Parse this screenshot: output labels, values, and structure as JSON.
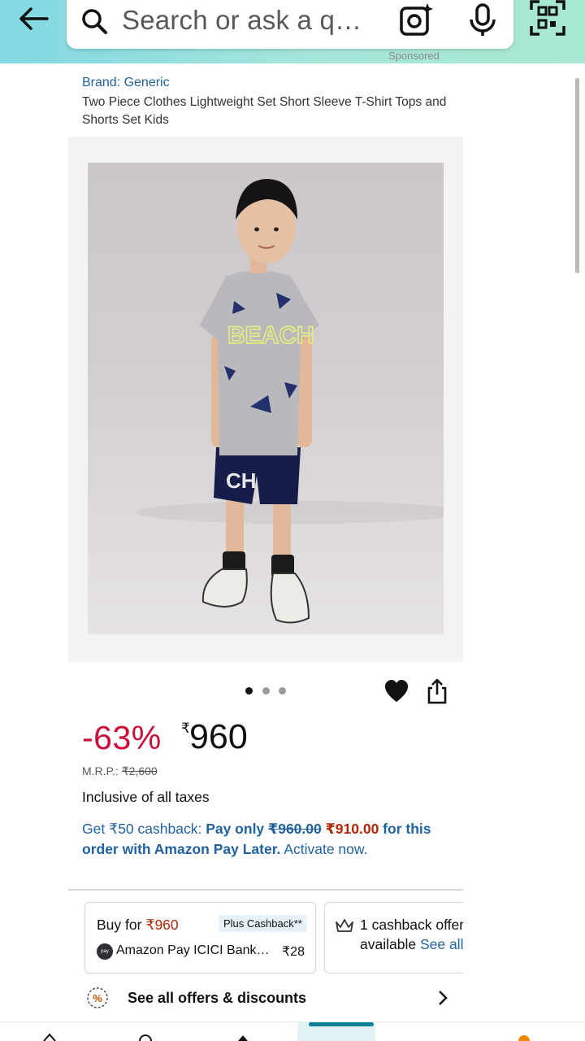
{
  "header": {
    "search_placeholder": "Search or ask a q…",
    "back_icon": "arrow-left-icon",
    "search_icon": "magnifier-icon",
    "lens_icon": "camera-lens-icon",
    "mic_icon": "microphone-icon",
    "qr_icon": "qr-scan-icon",
    "colors": {
      "gradient_start": "#82d8e3",
      "gradient_end": "#a9e8d1"
    }
  },
  "product": {
    "sponsored_label": "Sponsored",
    "brand": "Brand: Generic",
    "title": "Two Piece Clothes Lightweight Set Short Sleeve T-Shirt Tops and Shorts Set Kids",
    "image_count": 3,
    "active_image_index": 0,
    "tshirt_print": "BEACH",
    "discount": "-63%",
    "currency_symbol": "₹",
    "price": "960",
    "mrp_label": "M.R.P.:",
    "mrp_value": "₹2,600",
    "tax_note": "Inclusive of all taxes"
  },
  "cashback": {
    "part1": "Get ₹50 cashback: ",
    "part2": "Pay only ",
    "old_price": "₹960.00",
    "space": " ",
    "new_price": "₹910.00",
    "part3": " for this order with Amazon Pay Later.",
    "activate": " Activate now."
  },
  "offers": {
    "card1": {
      "buy_for": "Buy for ",
      "buy_price": "₹960",
      "tag": "Plus Cashback**",
      "bank_icon_text": "pay",
      "bank": "Amazon Pay ICICI Bank…",
      "amount": "₹28"
    },
    "card2": {
      "line1": "1 cashback offer",
      "line2": "available ",
      "link": "See all"
    },
    "see_all": "See all offers & discounts"
  },
  "colors": {
    "discount_red": "#cc0c39",
    "price_red": "#b12704",
    "link_blue": "#2162a1",
    "nav_accent": "#008296"
  }
}
